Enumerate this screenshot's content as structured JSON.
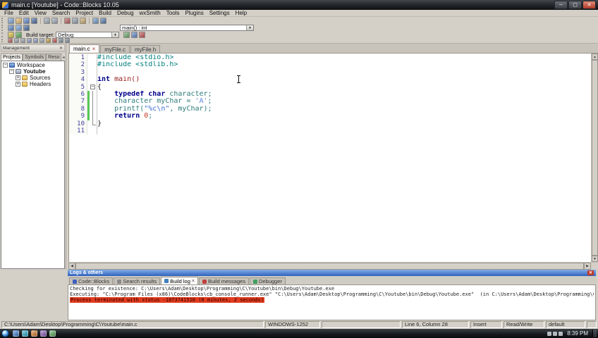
{
  "window": {
    "title": "main.c [Youtube] - Code::Blocks 10.05",
    "minimize": "─",
    "maximize": "▢",
    "close": "✕"
  },
  "menu": {
    "items": [
      "File",
      "Edit",
      "View",
      "Search",
      "Project",
      "Build",
      "Debug",
      "wxSmith",
      "Tools",
      "Plugins",
      "Settings",
      "Help"
    ]
  },
  "ui": {
    "dropdown_arrow": "▼",
    "arrow_left": "◀",
    "arrow_right": "▶",
    "arrow_up": "▲",
    "arrow_down": "▼",
    "fold_collapse": "−",
    "fold_expand": "+"
  },
  "toolbar": {
    "row1": [
      {
        "name": "new-file-icon",
        "color": "#7aa2d8"
      },
      {
        "name": "open-file-icon",
        "color": "#e5b86a"
      },
      {
        "name": "save-icon",
        "color": "#5f86c9"
      },
      {
        "name": "save-all-icon",
        "color": "#46689f"
      },
      {
        "name": "sep"
      },
      {
        "name": "undo-icon",
        "color": "#9aa8b8"
      },
      {
        "name": "redo-icon",
        "color": "#9aa8b8"
      },
      {
        "name": "sep"
      },
      {
        "name": "cut-icon",
        "color": "#b85a5a"
      },
      {
        "name": "copy-icon",
        "color": "#8f9cb0"
      },
      {
        "name": "paste-icon",
        "color": "#c9a86a"
      },
      {
        "name": "sep"
      },
      {
        "name": "find-icon",
        "color": "#6f97c9"
      },
      {
        "name": "replace-icon",
        "color": "#4f77a9"
      }
    ],
    "row2_icons": [
      {
        "name": "goto-function-icon",
        "color": "#5f86c9"
      },
      {
        "name": "goto-declaration-icon",
        "color": "#7aa2d8"
      },
      {
        "name": "goto-implementation-icon",
        "color": "#46689f"
      }
    ],
    "symbol_combo": {
      "value": "main() : int"
    },
    "row3_icons_left": [
      {
        "name": "compile-icon",
        "color": "#d8c040"
      },
      {
        "name": "run-icon",
        "color": "#58a858"
      }
    ],
    "build_target": {
      "label": "Build target:",
      "value": "Debug"
    },
    "row3_icons_right": [
      {
        "name": "build-and-run-icon",
        "color": "#6aa86a"
      },
      {
        "name": "rebuild-icon",
        "color": "#5f86c9"
      },
      {
        "name": "abort-build-icon",
        "color": "#c05050"
      }
    ],
    "row4": [
      {
        "name": "debug-continue-icon",
        "color": "#b85a5a"
      },
      {
        "name": "run-to-cursor-icon",
        "color": "#98a4b4"
      },
      {
        "name": "next-line-icon",
        "color": "#98a4b4"
      },
      {
        "name": "step-into-icon",
        "color": "#8898c8"
      },
      {
        "name": "step-out-icon",
        "color": "#8898c8"
      },
      {
        "name": "next-instruction-icon",
        "color": "#98a4b4"
      },
      {
        "name": "break-debugger-icon",
        "color": "#c8a040"
      },
      {
        "name": "stop-debugger-icon",
        "color": "#c05050"
      },
      {
        "name": "debug-windows-icon",
        "color": "#7a8aa0"
      },
      {
        "name": "debug-info-icon",
        "color": "#7a8aa0"
      }
    ]
  },
  "sidebar": {
    "header": "Management",
    "close": "✕",
    "scroll_left": "◂",
    "scroll_right": "▸",
    "tabs": [
      {
        "label": "Projects",
        "active": true
      },
      {
        "label": "Symbols",
        "active": false
      },
      {
        "label": "Reso",
        "active": false
      }
    ],
    "tree": [
      {
        "label": "Workspace",
        "level": 0,
        "icon": "workspace-icon",
        "expander": "minus",
        "bold": false
      },
      {
        "label": "Youtube",
        "level": 1,
        "icon": "project-icon",
        "expander": "minus",
        "bold": true
      },
      {
        "label": "Sources",
        "level": 2,
        "icon": "folder-icon",
        "expander": "plus",
        "bold": false
      },
      {
        "label": "Headers",
        "level": 2,
        "icon": "folder-icon",
        "expander": "plus",
        "bold": false
      }
    ]
  },
  "editor": {
    "tabs": [
      {
        "label": "main.c",
        "active": true,
        "close": "×"
      },
      {
        "label": "myFile.c",
        "active": false
      },
      {
        "label": "myFile.h",
        "active": false
      }
    ],
    "lines": [
      {
        "num": "1",
        "tokens": [
          {
            "t": "#include <stdio.h>",
            "c": "pp"
          }
        ]
      },
      {
        "num": "2",
        "tokens": [
          {
            "t": "#include <stdlib.h>",
            "c": "pp"
          }
        ]
      },
      {
        "num": "3",
        "tokens": []
      },
      {
        "num": "4",
        "tokens": [
          {
            "t": "int",
            "c": "kw"
          },
          {
            "t": " ",
            "c": "pl"
          },
          {
            "t": "main()",
            "c": "fn"
          }
        ]
      },
      {
        "num": "5",
        "fold": "start",
        "tokens": [
          {
            "t": "{",
            "c": "pl"
          }
        ]
      },
      {
        "num": "6",
        "fold": "mid",
        "changed": true,
        "tokens": [
          {
            "t": "    ",
            "c": "pl"
          },
          {
            "t": "typedef char",
            "c": "kw"
          },
          {
            "t": " character;",
            "c": "id"
          }
        ]
      },
      {
        "num": "7",
        "fold": "mid",
        "changed": true,
        "tokens": [
          {
            "t": "    character myChar = ",
            "c": "id"
          },
          {
            "t": "'A'",
            "c": "chr"
          },
          {
            "t": ";",
            "c": "id"
          }
        ]
      },
      {
        "num": "8",
        "fold": "mid",
        "changed": true,
        "tokens": [
          {
            "t": "    printf(",
            "c": "id"
          },
          {
            "t": "\"%c\\n\"",
            "c": "str"
          },
          {
            "t": ", myChar);",
            "c": "id"
          }
        ]
      },
      {
        "num": "9",
        "fold": "mid",
        "changed": true,
        "tokens": [
          {
            "t": "    ",
            "c": "pl"
          },
          {
            "t": "return",
            "c": "kw"
          },
          {
            "t": " ",
            "c": "pl"
          },
          {
            "t": "0",
            "c": "num"
          },
          {
            "t": ";",
            "c": "id"
          }
        ]
      },
      {
        "num": "10",
        "fold": "end",
        "tokens": [
          {
            "t": "}",
            "c": "pl"
          }
        ]
      },
      {
        "num": "11",
        "tokens": []
      }
    ]
  },
  "logs": {
    "header": "Logs & others",
    "close": "✕",
    "tabs": [
      {
        "label": "Code::Blocks",
        "icon": "#4060c0",
        "active": false
      },
      {
        "label": "Search results",
        "icon": "#8a8a8a",
        "active": false
      },
      {
        "label": "Build log",
        "icon": "#4080c0",
        "active": true,
        "close": "×"
      },
      {
        "label": "Build messages",
        "icon": "#c04040",
        "active": false
      },
      {
        "label": "Debugger",
        "icon": "#40a060",
        "active": false
      }
    ],
    "lines": [
      {
        "type": "normal",
        "text": "Checking for existence: C:\\Users\\Adam\\Desktop\\Programming\\C\\Youtube\\bin\\Debug\\Youtube.exe"
      },
      {
        "type": "normal",
        "text": "Executing: \"C:\\Program Files (x86)\\CodeBlocks\\cb_console_runner.exe\" \"C:\\Users\\Adam\\Desktop\\Programming\\C\\Youtube\\bin\\Debug\\Youtube.exe\"  (in C:\\Users\\Adam\\Desktop\\Programming\\C\\Youtube\\.)"
      },
      {
        "type": "error",
        "text": "Process terminated with status -1073741510 (0 minutes, 2 seconds)"
      }
    ]
  },
  "statusbar": {
    "path": "C:\\Users\\Adam\\Desktop\\Programming\\C\\Youtube\\main.c",
    "encoding": "WINDOWS-1252",
    "position": "Line 6, Column 28",
    "overwrite": "Insert",
    "readwrite": "Read/Write",
    "profile": "default"
  },
  "taskbar": {
    "clock": "8:39 PM",
    "apps": [
      {
        "name": "taskbar-app-icon-1",
        "color": "#3f7fd0"
      },
      {
        "name": "taskbar-app-icon-2",
        "color": "#28a8c8"
      },
      {
        "name": "taskbar-app-icon-3",
        "color": "#d87828"
      },
      {
        "name": "taskbar-app-icon-4",
        "color": "#8858b8"
      },
      {
        "name": "taskbar-app-icon-5",
        "color": "#58a858"
      }
    ],
    "tray": [
      {
        "name": "tray-show-hidden-icon"
      },
      {
        "name": "tray-network-icon"
      },
      {
        "name": "tray-volume-icon"
      }
    ]
  }
}
